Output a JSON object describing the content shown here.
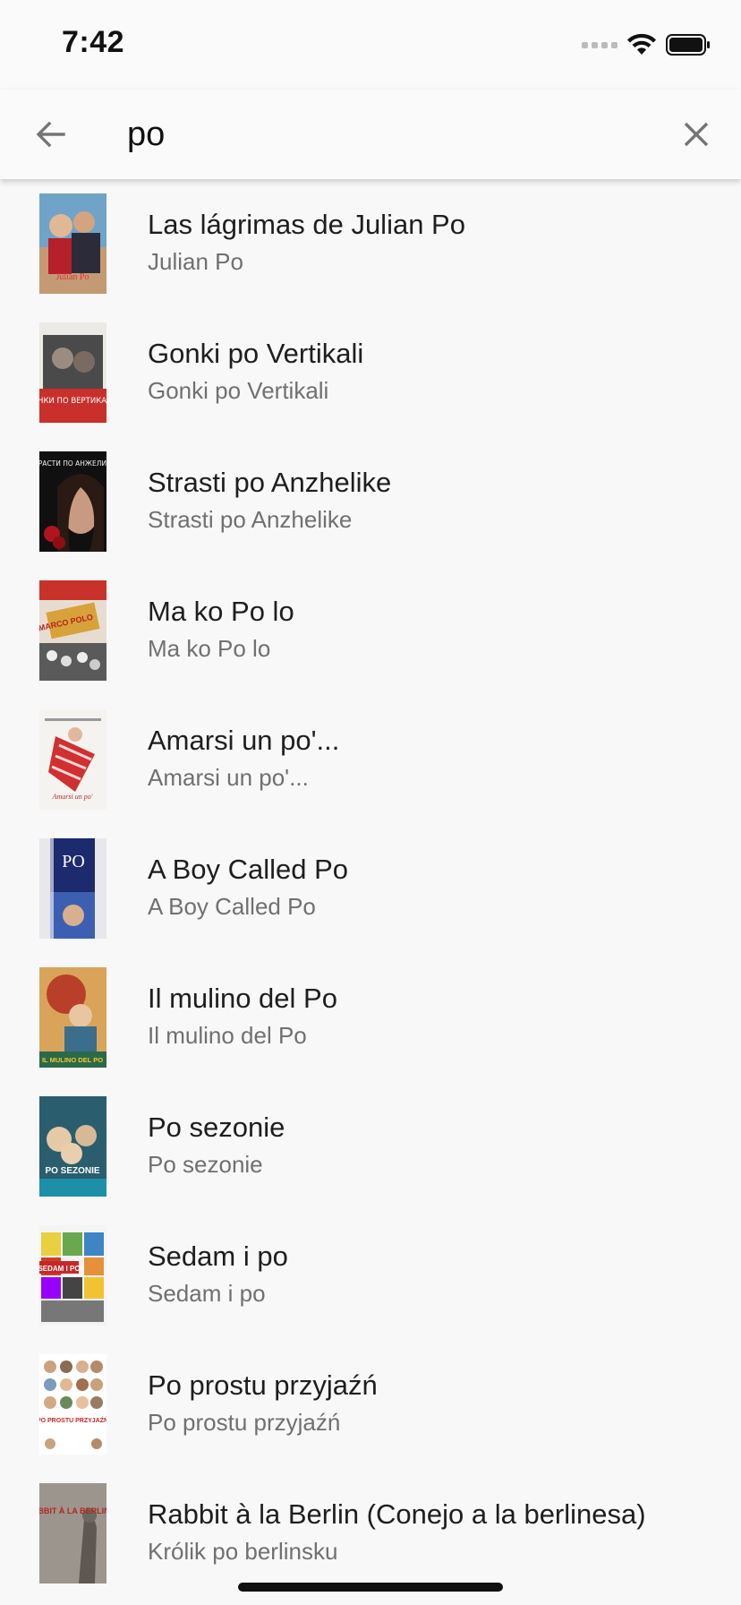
{
  "status_bar": {
    "time": "7:42"
  },
  "search": {
    "query": "po"
  },
  "results": [
    {
      "title": "Las lágrimas de Julian Po",
      "subtitle": "Julian Po",
      "poster_label": "Julian Po"
    },
    {
      "title": "Gonki po Vertikali",
      "subtitle": "Gonki po Vertikali",
      "poster_label": "ГОНКИ ПО ВЕРТИКАЛИ"
    },
    {
      "title": "Strasti po Anzhelike",
      "subtitle": "Strasti po Anzhelike",
      "poster_label": "СТРАСТИ ПО АНЖЕЛИКЕ"
    },
    {
      "title": "Ma ko Po lo",
      "subtitle": "Ma ko Po lo",
      "poster_label": "MARCO POLO"
    },
    {
      "title": "Amarsi un po'...",
      "subtitle": "Amarsi un po'...",
      "poster_label": "Amarsi un po'"
    },
    {
      "title": "A Boy Called Po",
      "subtitle": "A Boy Called Po",
      "poster_label": "PO"
    },
    {
      "title": "Il mulino del Po",
      "subtitle": "Il mulino del Po",
      "poster_label": "IL MULINO DEL PO"
    },
    {
      "title": "Po sezonie",
      "subtitle": "Po sezonie",
      "poster_label": "PO SEZONIE"
    },
    {
      "title": "Sedam i po",
      "subtitle": "Sedam i po",
      "poster_label": "SEDAM I PO"
    },
    {
      "title": "Po prostu przyjaźń",
      "subtitle": "Po prostu przyjaźń",
      "poster_label": "PO PROSTU PRZYJAŹŃ"
    },
    {
      "title": "Rabbit à la Berlin (Conejo a la berlinesa)",
      "subtitle": "Królik po berlinsku",
      "poster_label": "RABBIT À LA BERLIN"
    }
  ]
}
